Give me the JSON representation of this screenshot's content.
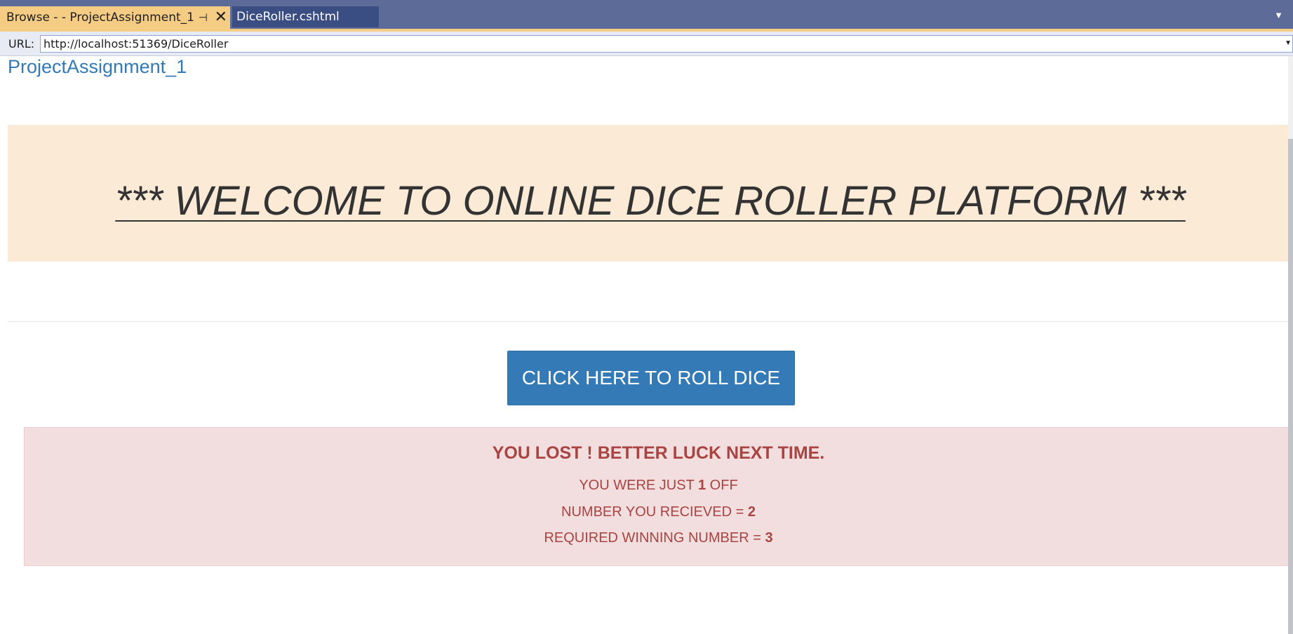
{
  "tabs": {
    "active": {
      "label": "Browse - - ProjectAssignment_1",
      "pin_icon": "pin-icon",
      "close_icon": "close-icon"
    },
    "inactive": {
      "label": "DiceRoller.cshtml"
    }
  },
  "urlbar": {
    "label": "URL:",
    "value": "http://localhost:51369/DiceRoller"
  },
  "page": {
    "brand": "ProjectAssignment_1",
    "welcome": "*** WELCOME TO ONLINE DICE ROLLER PLATFORM ***",
    "roll_button": "CLICK HERE TO ROLL DICE",
    "result": {
      "title": "YOU LOST ! BETTER LUCK NEXT TIME.",
      "off_prefix": "YOU WERE JUST ",
      "off_value": "1",
      "off_suffix": " OFF",
      "received_prefix": "NUMBER YOU RECIEVED = ",
      "received_value": "2",
      "winning_prefix": "REQUIRED WINNING NUMBER = ",
      "winning_value": "3"
    }
  },
  "colors": {
    "tab_strip": "#5d6b99",
    "active_tab": "#f5cc84",
    "link_blue": "#337ab7",
    "jumbotron": "#fbebd6",
    "alert_bg": "#f2dede",
    "alert_text": "#a94442"
  }
}
